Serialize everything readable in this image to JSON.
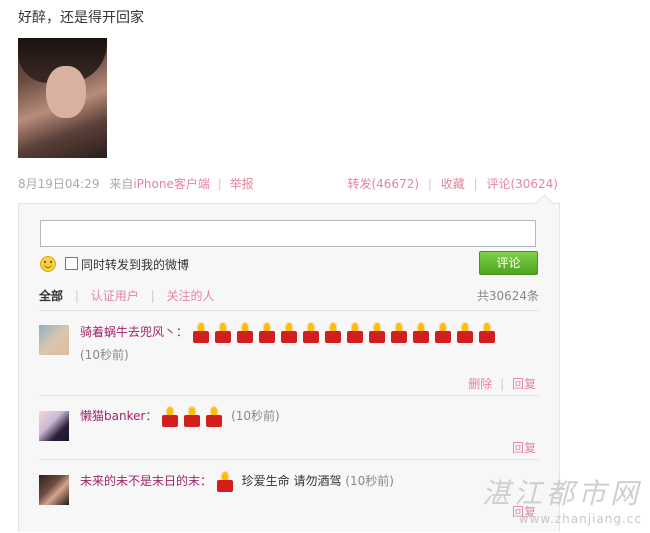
{
  "post": {
    "text": "好醉，还是得开回家",
    "date": "8月19日04:29",
    "source_prefix": "来自",
    "source": "iPhone客户端",
    "report": "举报",
    "repost": "转发(46672)",
    "favorite": "收藏",
    "comment": "评论(30624)"
  },
  "composer": {
    "input_value": "",
    "checkbox_label": "同时转发到我的微博",
    "submit_label": "评论"
  },
  "filters": {
    "all": "全部",
    "verified": "认证用户",
    "following": "关注的人",
    "total": "共30624条"
  },
  "comments": [
    {
      "user": "骑着蜗牛去兜风丶：",
      "candles": 14,
      "text": "",
      "time": "(10秒前)",
      "delete": "删除",
      "reply": "回复"
    },
    {
      "user": "懒猫banker：",
      "candles": 3,
      "text": "",
      "time": "(10秒前)",
      "reply": "回复"
    },
    {
      "user": "未来的未不是末日的末：",
      "candles": 1,
      "text": "珍爱生命 请勿酒驾",
      "time": "(10秒前)",
      "reply": "回复"
    }
  ],
  "watermark": {
    "name": "湛江都市网",
    "url": "www.zhanjiang.cc"
  },
  "colors": {
    "link": "#e4859d",
    "username": "#a3236a",
    "button": "#5cb82b"
  }
}
